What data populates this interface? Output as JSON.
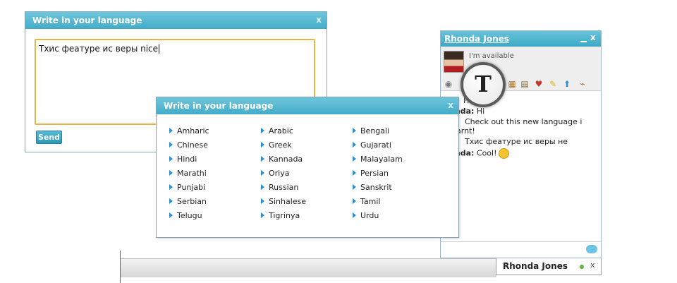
{
  "dialog_top": {
    "title": "Write in your language",
    "close": "x",
    "text_value": "Тхис феатуре ис веры nice",
    "send_label": "Send"
  },
  "dialog_languages": {
    "title": "Write in your language",
    "close": "x",
    "languages": [
      [
        "Amharic",
        "Arabic",
        "Bengali"
      ],
      [
        "Chinese",
        "Greek",
        "Gujarati"
      ],
      [
        "Hindi",
        "Kannada",
        "Malayalam"
      ],
      [
        "Marathi",
        "Oriya",
        "Persian"
      ],
      [
        "Punjabi",
        "Russian",
        "Sanskrit"
      ],
      [
        "Serbian",
        "Sinhalese",
        "Tamil"
      ],
      [
        "Telugu",
        "Tigrinya",
        "Urdu"
      ]
    ]
  },
  "chat": {
    "contact_name": "Rhonda Jones",
    "status": "I'm available",
    "close": "x",
    "toolbar_icons": [
      "webcam-icon",
      "transliterate-icon",
      "calendar-icon",
      "notes-icon",
      "cards-icon",
      "pencil-icon",
      "upload-icon",
      "broom-icon"
    ],
    "zoomed_letter": "T",
    "messages": [
      {
        "sender": "",
        "text": "Hi"
      },
      {
        "sender": "Rhonda:",
        "text": "Hi"
      },
      {
        "sender": "",
        "text": "Check out this new language i"
      },
      {
        "sender": "",
        "text": "arnt!"
      },
      {
        "sender": "",
        "text": "Тхис феатуре ис веры  не"
      },
      {
        "sender": "Rhonda:",
        "text": "Cool!"
      }
    ]
  },
  "taskbar": {
    "tab_name": "Rhonda Jones",
    "tab_close": "x"
  },
  "colors": {
    "header": "#44acc8",
    "input_border": "#e8b648",
    "online": "#5fb33d",
    "link_arrow": "#2f8fd0"
  }
}
